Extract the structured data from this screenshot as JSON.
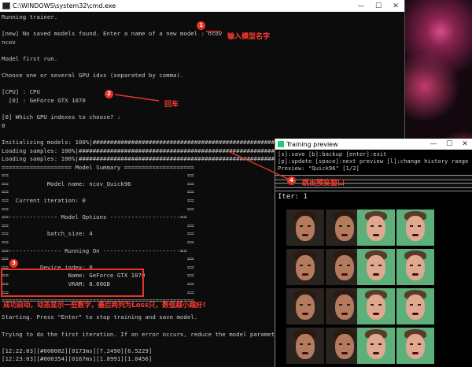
{
  "cmd_window": {
    "title": "C:\\WINDOWS\\system32\\cmd.exe",
    "minimize": "—",
    "maximize": "☐",
    "close": "✕"
  },
  "console_lines": [
    "Running trainer.",
    "",
    "[new] No saved models found. Enter a name of a new model : ncov",
    "ncov",
    "",
    "Model first run.",
    "",
    "Choose one or several GPU idxs (separated by comma).",
    "",
    "[CPU] : CPU",
    "  [0] : GeForce GTX 1070",
    "",
    "[0] Which GPU indexes to choose? :",
    "0",
    "",
    "Initializing models: 100%|##########################################################| 5/5 [00:05<00:00,  1.02s/it]",
    "Loading samples: 100%|############################################################| 654/654 [00:01<00:00, 519.76it/s]",
    "Loading samples: 100%|############################################################| 1522/1522 [00:02<00:00, 549.77it/s]",
    "==================== Model Summary ====================",
    "==                                                   ==",
    "==           Model name: ncov_Quick96                ==",
    "==                                                   ==",
    "==  Current iteration: 0                             ==",
    "==                                                   ==",
    "==-------------- Model Options --------------------==",
    "==                                                   ==",
    "==           batch_size: 4                           ==",
    "==                                                   ==",
    "==--------------- Running On ----------------------==",
    "==                                                   ==",
    "==         Device index: 0                           ==",
    "==                 Name: GeForce GTX 1070            ==",
    "==                 VRAM: 8.00GB                      ==",
    "==                                                   ==",
    "=======================================================",
    "",
    "Starting. Press \"Enter\" to stop training and save model.",
    "",
    "Trying to do the first iteration. If an error occurs, reduce the model parameters.",
    "",
    "[12:22:03][#000002][0173ms][7.2490][6.5229]",
    "[12:23:03][#000354][0167ms][1.8991][1.0456]"
  ],
  "annotations": [
    {
      "num": "1",
      "text": "输入模型名字"
    },
    {
      "num": "2",
      "text": "回车"
    },
    {
      "num": "3",
      "text": "成功启动，动态显示一些数字，最后两列为Loss只，数值越小越好!"
    },
    {
      "num": "4",
      "text": "跳出预览窗口"
    }
  ],
  "preview_window": {
    "title": "Training preview",
    "minimize": "—",
    "maximize": "☐",
    "close": "✕",
    "help_line1": "[s]:save [b]:backup [enter]:exit",
    "help_line2": "[p]:update [space]:next preview [l]:change history range",
    "help_line3": "Preview: \"Quick96\" [1/2]",
    "iter_label": "Iter: 1"
  },
  "colors": {
    "annotation_red": "#e6332a",
    "console_bg": "#0c0c0c",
    "console_fg": "#c8c8c8",
    "face_bg_green": "#5db07a"
  },
  "icons": {
    "cmd": "terminal-icon",
    "preview": "window-icon"
  }
}
